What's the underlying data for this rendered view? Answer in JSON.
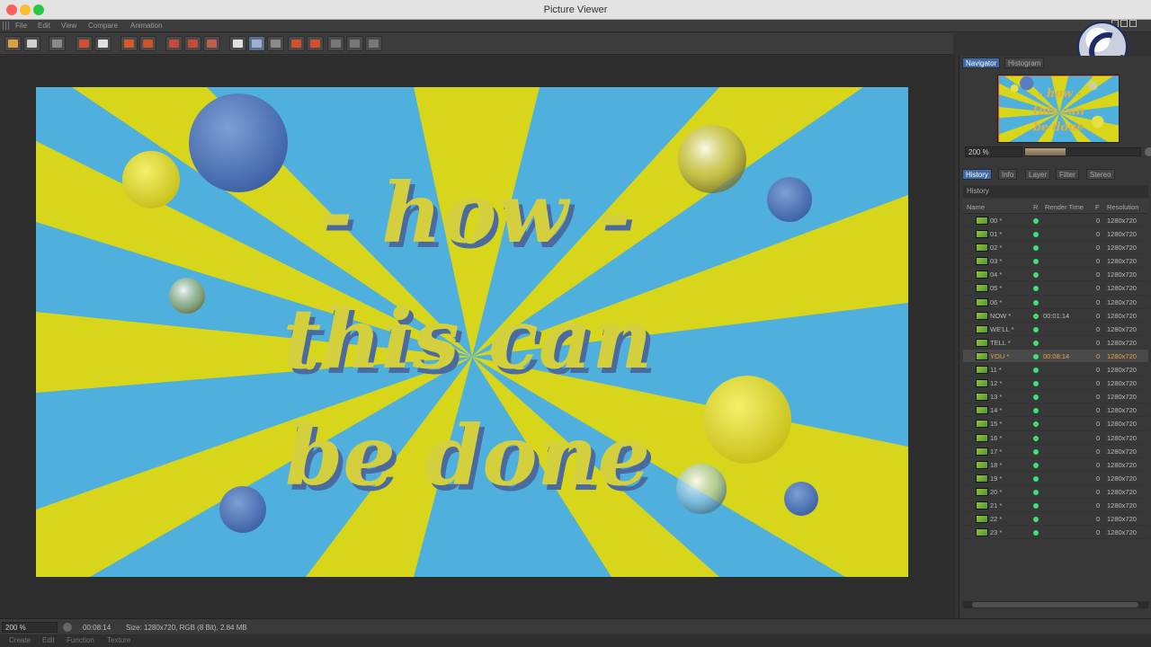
{
  "window": {
    "title": "Picture Viewer"
  },
  "menu": [
    "File",
    "Edit",
    "View",
    "Compare",
    "Animation"
  ],
  "render": {
    "lines": [
      "- how -",
      "this can",
      "be done"
    ]
  },
  "panel": {
    "tabs_top": [
      "Navigator",
      "Histogram"
    ],
    "zoom": "200 %",
    "zoom_level": 0.35,
    "tabs_mid": [
      "History",
      "Info",
      "Layer",
      "Filter",
      "Stereo"
    ],
    "history_title": "History",
    "columns": [
      "Name",
      "R",
      "Render Time",
      "F",
      "Resolution"
    ],
    "rows": [
      {
        "name": "00 *",
        "time": "",
        "f": "0",
        "res": "1280x720"
      },
      {
        "name": "01 *",
        "time": "",
        "f": "0",
        "res": "1280x720"
      },
      {
        "name": "02 *",
        "time": "",
        "f": "0",
        "res": "1280x720"
      },
      {
        "name": "03 *",
        "time": "",
        "f": "0",
        "res": "1280x720"
      },
      {
        "name": "04 *",
        "time": "",
        "f": "0",
        "res": "1280x720"
      },
      {
        "name": "05 *",
        "time": "",
        "f": "0",
        "res": "1280x720"
      },
      {
        "name": "06 *",
        "time": "",
        "f": "0",
        "res": "1280x720"
      },
      {
        "name": "NOW *",
        "time": "00:01:14",
        "f": "0",
        "res": "1280x720"
      },
      {
        "name": "WE'LL *",
        "time": "",
        "f": "0",
        "res": "1280x720"
      },
      {
        "name": "TELL *",
        "time": "",
        "f": "0",
        "res": "1280x720"
      },
      {
        "name": "YOU *",
        "time": "00:08:14",
        "f": "0",
        "res": "1280x720",
        "selected": true
      },
      {
        "name": "11 *",
        "time": "",
        "f": "0",
        "res": "1280x720"
      },
      {
        "name": "12 *",
        "time": "",
        "f": "0",
        "res": "1280x720"
      },
      {
        "name": "13 *",
        "time": "",
        "f": "0",
        "res": "1280x720"
      },
      {
        "name": "14 *",
        "time": "",
        "f": "0",
        "res": "1280x720"
      },
      {
        "name": "15 *",
        "time": "",
        "f": "0",
        "res": "1280x720"
      },
      {
        "name": "16 *",
        "time": "",
        "f": "0",
        "res": "1280x720"
      },
      {
        "name": "17 *",
        "time": "",
        "f": "0",
        "res": "1280x720"
      },
      {
        "name": "18 *",
        "time": "",
        "f": "0",
        "res": "1280x720"
      },
      {
        "name": "19 *",
        "time": "",
        "f": "0",
        "res": "1280x720"
      },
      {
        "name": "20 *",
        "time": "",
        "f": "0",
        "res": "1280x720"
      },
      {
        "name": "21 *",
        "time": "",
        "f": "0",
        "res": "1280x720"
      },
      {
        "name": "22 *",
        "time": "",
        "f": "0",
        "res": "1280x720"
      },
      {
        "name": "23 *",
        "time": "",
        "f": "0",
        "res": "1280x720"
      }
    ]
  },
  "status": {
    "zoom": "200 %",
    "time": "00:08:14",
    "info": "Size: 1280x720, RGB (8 Bit), 2.84 MB"
  },
  "bottom_menu": [
    "Create",
    "Edit",
    "Function",
    "Texture"
  ],
  "colors": {
    "stripe_blue": "#4fb0dd",
    "stripe_yellow": "#d8d61a",
    "text_yellow": "#d4cf3c",
    "selected_time": "#e8a040",
    "status_dot": "#3fe07a"
  }
}
